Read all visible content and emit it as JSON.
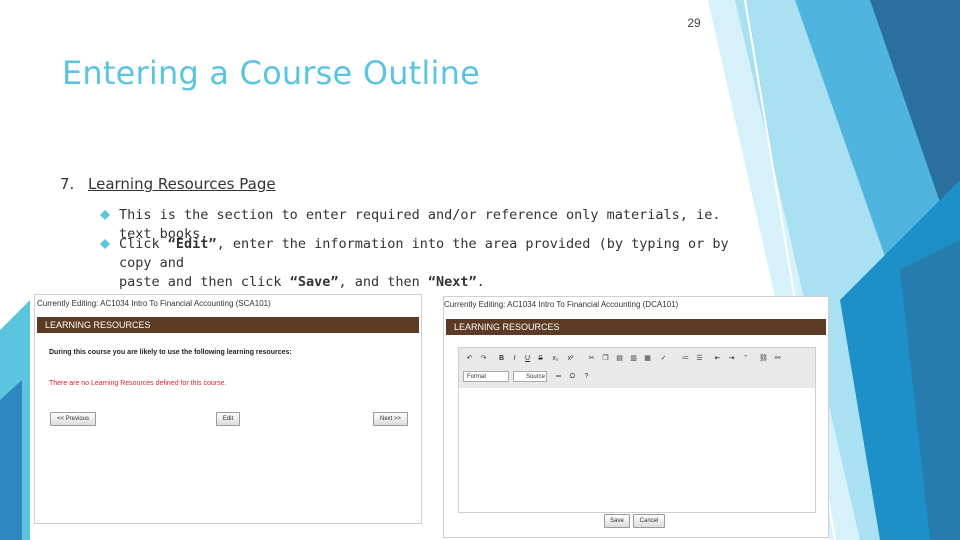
{
  "slide": {
    "number": "29",
    "title": "Entering a Course Outline",
    "section_number": "7.",
    "section_heading": "Learning Resources Page",
    "accent_color": "#5bc5e0",
    "bullets": [
      {
        "text_parts": [
          "This is the section to enter required and/or reference only materials, ie. text books."
        ]
      },
      {
        "line1_a": "Click ",
        "line1_b": "“Edit”",
        "line1_c": ", enter the information into the area provided (by typing or by copy and",
        "line2_a": "paste and then click ",
        "line2_b": "“Save”",
        "line2_c": ", and then ",
        "line2_d": "“Next”",
        "line2_e": "."
      }
    ]
  },
  "screenshot_left": {
    "editing_label": "Currently Editing: AC1034 Intro To Financial Accounting (SCA101)",
    "bar_title": "LEARNING RESOURCES",
    "intro": "During this course you are likely to use the following learning resources:",
    "warning": "There are no Learning Resources defined for this course.",
    "buttons": {
      "previous": "<< Previous",
      "edit": "Edit",
      "next": "Next >>"
    },
    "warning_color": "#d9272e",
    "bar_color": "#5b3b23"
  },
  "screenshot_right": {
    "editing_label": "Currently Editing: AC1034 Intro To Financial Accounting (DCA101)",
    "bar_title": "LEARNING RESOURCES",
    "format_label": "Format",
    "source_label": "Source",
    "buttons": {
      "save": "Save",
      "cancel": "Cancel"
    }
  }
}
